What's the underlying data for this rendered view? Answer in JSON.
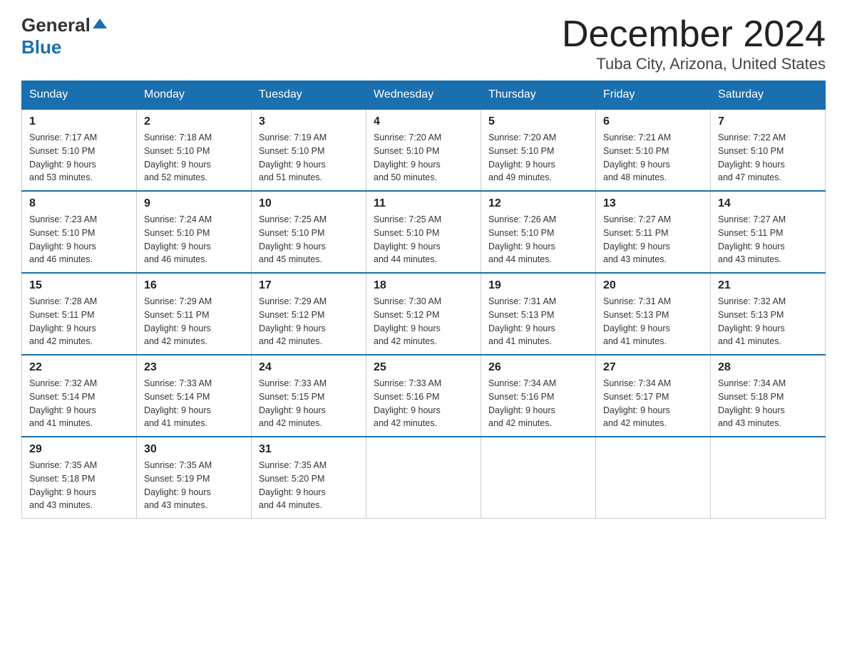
{
  "header": {
    "logo_general": "General",
    "logo_blue": "Blue",
    "month": "December 2024",
    "location": "Tuba City, Arizona, United States"
  },
  "days_of_week": [
    "Sunday",
    "Monday",
    "Tuesday",
    "Wednesday",
    "Thursday",
    "Friday",
    "Saturday"
  ],
  "weeks": [
    [
      {
        "day": "1",
        "sunrise": "7:17 AM",
        "sunset": "5:10 PM",
        "daylight": "9 hours and 53 minutes."
      },
      {
        "day": "2",
        "sunrise": "7:18 AM",
        "sunset": "5:10 PM",
        "daylight": "9 hours and 52 minutes."
      },
      {
        "day": "3",
        "sunrise": "7:19 AM",
        "sunset": "5:10 PM",
        "daylight": "9 hours and 51 minutes."
      },
      {
        "day": "4",
        "sunrise": "7:20 AM",
        "sunset": "5:10 PM",
        "daylight": "9 hours and 50 minutes."
      },
      {
        "day": "5",
        "sunrise": "7:20 AM",
        "sunset": "5:10 PM",
        "daylight": "9 hours and 49 minutes."
      },
      {
        "day": "6",
        "sunrise": "7:21 AM",
        "sunset": "5:10 PM",
        "daylight": "9 hours and 48 minutes."
      },
      {
        "day": "7",
        "sunrise": "7:22 AM",
        "sunset": "5:10 PM",
        "daylight": "9 hours and 47 minutes."
      }
    ],
    [
      {
        "day": "8",
        "sunrise": "7:23 AM",
        "sunset": "5:10 PM",
        "daylight": "9 hours and 46 minutes."
      },
      {
        "day": "9",
        "sunrise": "7:24 AM",
        "sunset": "5:10 PM",
        "daylight": "9 hours and 46 minutes."
      },
      {
        "day": "10",
        "sunrise": "7:25 AM",
        "sunset": "5:10 PM",
        "daylight": "9 hours and 45 minutes."
      },
      {
        "day": "11",
        "sunrise": "7:25 AM",
        "sunset": "5:10 PM",
        "daylight": "9 hours and 44 minutes."
      },
      {
        "day": "12",
        "sunrise": "7:26 AM",
        "sunset": "5:10 PM",
        "daylight": "9 hours and 44 minutes."
      },
      {
        "day": "13",
        "sunrise": "7:27 AM",
        "sunset": "5:11 PM",
        "daylight": "9 hours and 43 minutes."
      },
      {
        "day": "14",
        "sunrise": "7:27 AM",
        "sunset": "5:11 PM",
        "daylight": "9 hours and 43 minutes."
      }
    ],
    [
      {
        "day": "15",
        "sunrise": "7:28 AM",
        "sunset": "5:11 PM",
        "daylight": "9 hours and 42 minutes."
      },
      {
        "day": "16",
        "sunrise": "7:29 AM",
        "sunset": "5:11 PM",
        "daylight": "9 hours and 42 minutes."
      },
      {
        "day": "17",
        "sunrise": "7:29 AM",
        "sunset": "5:12 PM",
        "daylight": "9 hours and 42 minutes."
      },
      {
        "day": "18",
        "sunrise": "7:30 AM",
        "sunset": "5:12 PM",
        "daylight": "9 hours and 42 minutes."
      },
      {
        "day": "19",
        "sunrise": "7:31 AM",
        "sunset": "5:13 PM",
        "daylight": "9 hours and 41 minutes."
      },
      {
        "day": "20",
        "sunrise": "7:31 AM",
        "sunset": "5:13 PM",
        "daylight": "9 hours and 41 minutes."
      },
      {
        "day": "21",
        "sunrise": "7:32 AM",
        "sunset": "5:13 PM",
        "daylight": "9 hours and 41 minutes."
      }
    ],
    [
      {
        "day": "22",
        "sunrise": "7:32 AM",
        "sunset": "5:14 PM",
        "daylight": "9 hours and 41 minutes."
      },
      {
        "day": "23",
        "sunrise": "7:33 AM",
        "sunset": "5:14 PM",
        "daylight": "9 hours and 41 minutes."
      },
      {
        "day": "24",
        "sunrise": "7:33 AM",
        "sunset": "5:15 PM",
        "daylight": "9 hours and 42 minutes."
      },
      {
        "day": "25",
        "sunrise": "7:33 AM",
        "sunset": "5:16 PM",
        "daylight": "9 hours and 42 minutes."
      },
      {
        "day": "26",
        "sunrise": "7:34 AM",
        "sunset": "5:16 PM",
        "daylight": "9 hours and 42 minutes."
      },
      {
        "day": "27",
        "sunrise": "7:34 AM",
        "sunset": "5:17 PM",
        "daylight": "9 hours and 42 minutes."
      },
      {
        "day": "28",
        "sunrise": "7:34 AM",
        "sunset": "5:18 PM",
        "daylight": "9 hours and 43 minutes."
      }
    ],
    [
      {
        "day": "29",
        "sunrise": "7:35 AM",
        "sunset": "5:18 PM",
        "daylight": "9 hours and 43 minutes."
      },
      {
        "day": "30",
        "sunrise": "7:35 AM",
        "sunset": "5:19 PM",
        "daylight": "9 hours and 43 minutes."
      },
      {
        "day": "31",
        "sunrise": "7:35 AM",
        "sunset": "5:20 PM",
        "daylight": "9 hours and 44 minutes."
      },
      null,
      null,
      null,
      null
    ]
  ],
  "labels": {
    "sunrise": "Sunrise:",
    "sunset": "Sunset:",
    "daylight": "Daylight:"
  }
}
